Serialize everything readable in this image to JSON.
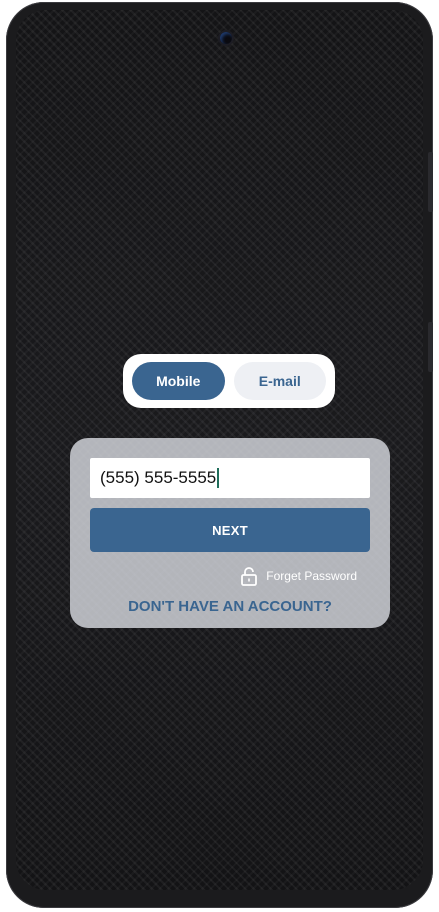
{
  "login_mode": {
    "options": [
      {
        "label": "Mobile",
        "active": true
      },
      {
        "label": "E-mail",
        "active": false
      }
    ]
  },
  "form": {
    "phone_value": "(555) 555-5555",
    "next_label": "NEXT",
    "forgot_label": "Forget Password",
    "forgot_icon": "lock-icon",
    "signup_label": "DON'T HAVE AN ACCOUNT?"
  },
  "colors": {
    "accent": "#3a6590",
    "card": "#d6d8de",
    "background": "#111113"
  }
}
